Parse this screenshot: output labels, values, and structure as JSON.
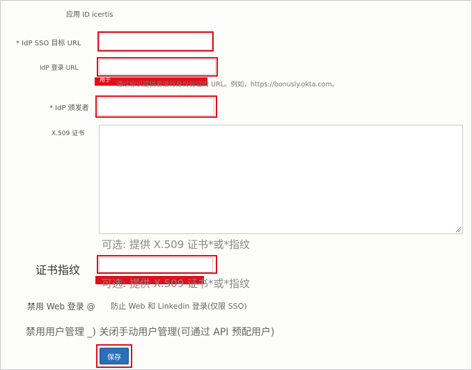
{
  "app": {
    "app_id_label": "应用 ID icertis"
  },
  "fields": {
    "sso_target": {
      "label": "* IdP SSO 目标 URL",
      "value": ""
    },
    "login_url": {
      "label": "IdP 登录 URL",
      "value": "",
      "hint_prefix": "用于",
      "hint_text": "通过标识提供者进行身份验证的 URL。例如，https://bonusly.okta.com。"
    },
    "issuer": {
      "label": "* IdP 颁发者",
      "value": ""
    },
    "x509": {
      "label": "X.509 证书",
      "value": "",
      "hint": "可选: 提供 X.509 证书*或*指纹"
    },
    "fingerprint": {
      "label": "证书指纹",
      "value": "",
      "hint": "可选: 提供 X.509 证书*或*指纹"
    }
  },
  "options": {
    "disable_web_login": {
      "label": "禁用 Web 登录 @",
      "description": "防止 Web 和 Linkedin 登录(仅限 SSO)"
    },
    "disable_user_mgmt": {
      "text": "禁用用户管理 _) 关闭手动用户管理(可通过 API 预配用户)"
    }
  },
  "actions": {
    "save_label": "保存"
  },
  "colors": {
    "highlight": "#e0101a",
    "primary_button": "#2a6fb7"
  }
}
